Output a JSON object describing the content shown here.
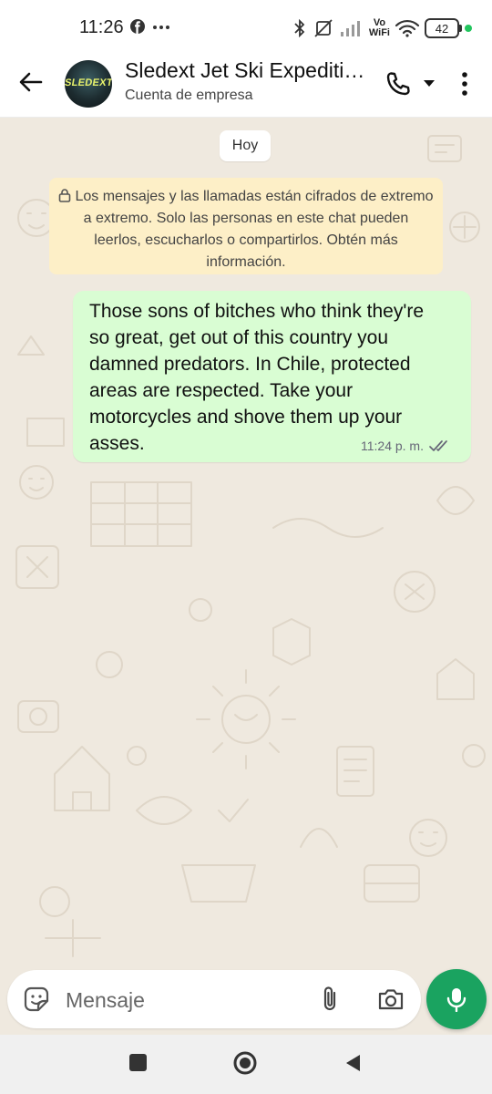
{
  "status_bar": {
    "time": "11:26",
    "battery": "42",
    "network_label": "Vo\nWiFi",
    "icons": [
      "facebook-icon",
      "more-dots-icon",
      "bluetooth-icon",
      "mute-icon",
      "signal-icon",
      "wifi-icon",
      "battery-icon"
    ]
  },
  "header": {
    "contact_name": "Sledext Jet Ski Expediti…",
    "contact_subtitle": "Cuenta de empresa",
    "avatar_text": "SLEDEXT",
    "icons": [
      "back-arrow-icon",
      "phone-icon",
      "caret-down-icon",
      "more-vert-icon"
    ]
  },
  "chat": {
    "date_chip": "Hoy",
    "encryption_notice": "Los mensajes y las llamadas están cifrados de extremo a extremo. Solo las personas en este chat pueden leerlos, escucharlos o compartirlos. Obtén más información.",
    "messages": [
      {
        "direction": "outgoing",
        "text": "Those sons of bitches who think they're so great, get out of this country you damned predators. In Chile, protected areas are respected. Take your motorcycles and shove them up your asses.",
        "time": "11:24 p. m.",
        "status": "read"
      }
    ]
  },
  "composer": {
    "placeholder": "Mensaje",
    "icons": [
      "sticker-icon",
      "paperclip-icon",
      "camera-icon",
      "mic-icon"
    ]
  },
  "colors": {
    "accent_green": "#1aa360",
    "outgoing_bubble": "#d9fdd3",
    "notice_bg": "#fdefc7",
    "chat_bg": "#efe9df"
  }
}
